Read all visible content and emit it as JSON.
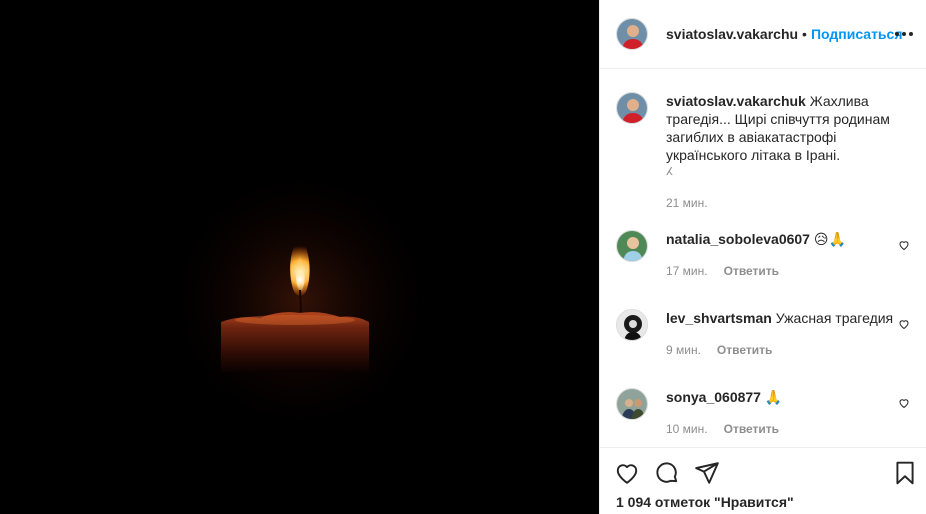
{
  "post": {
    "author": "sviatoslav.vakarchuk",
    "header_username": "sviatoslav.vakarchu",
    "separator": "•",
    "follow_label": "Подписаться",
    "media_description_icon": "candle-photo"
  },
  "caption": {
    "username": "sviatoslav.vakarchuk",
    "text": "Жахлива трагедія... Щирі співчуття родинам загиблих в авіакатастрофі українського літака в Ірані.",
    "extra": "ⵃ",
    "time": "21 мин."
  },
  "comments": [
    {
      "username": "natalia_soboleva0607",
      "text": "😥🙏",
      "time": "17 мин.",
      "reply": "Ответить"
    },
    {
      "username": "lev_shvartsman",
      "text": "Ужасная трагедия",
      "time": "9 мин.",
      "reply": "Ответить"
    },
    {
      "username": "sonya_060877",
      "text": "🙏",
      "time": "10 мин.",
      "reply": "Ответить"
    }
  ],
  "footer": {
    "likes": "1 094 отметок \"Нравится\"",
    "icons": [
      "heart-icon",
      "comment-icon",
      "share-icon",
      "bookmark-icon"
    ]
  },
  "colors": {
    "accent": "#0095f6",
    "text": "#262626",
    "muted": "#8e8e8e",
    "border": "#efefef"
  }
}
